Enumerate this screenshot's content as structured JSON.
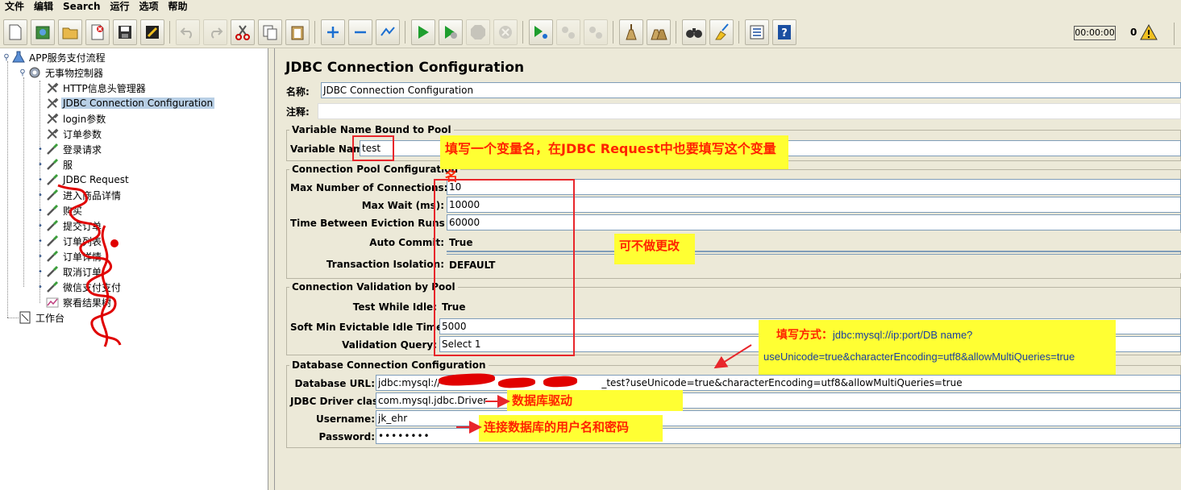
{
  "menu": [
    "文件",
    "编辑",
    "Search",
    "运行",
    "选项",
    "帮助"
  ],
  "toolbar": {
    "timer": "00:00:00",
    "error_count": "0"
  },
  "tree": {
    "root": "APP服务支付流程",
    "controller": "无事物控制器",
    "items": [
      "HTTP信息头管理器",
      "JDBC Connection Configuration",
      "login参数",
      "订单参数",
      "登录请求",
      "服",
      "JDBC Request",
      "进入商品详情",
      "购买",
      "提交订单",
      "订单列表",
      "订单详情",
      "取消订单",
      "微信支付支付",
      "察看结果树"
    ],
    "workbench": "工作台"
  },
  "main": {
    "title": "JDBC Connection Configuration",
    "name_label": "名称:",
    "name_value": "JDBC Connection Configuration",
    "comment_label": "注释:",
    "comment_value": "",
    "variable_group": {
      "legend": "Variable Name Bound to Pool",
      "variable_label": "Variable Name:",
      "variable_value": "test"
    },
    "pool_group": {
      "legend": "Connection Pool Configuration",
      "max_conn_label": "Max Number of Connections:",
      "max_conn_value": "10",
      "max_wait_label": "Max Wait (ms):",
      "max_wait_value": "10000",
      "eviction_label": "Time Between Eviction Runs (ms):",
      "eviction_value": "60000",
      "auto_commit_label": "Auto Commit:",
      "auto_commit_value": "True",
      "isolation_label": "Transaction Isolation:",
      "isolation_value": "DEFAULT"
    },
    "validation_group": {
      "legend": "Connection Validation by Pool",
      "test_idle_label": "Test While Idle:",
      "test_idle_value": "True",
      "soft_min_label": "Soft Min Evictable Idle Time(ms):",
      "soft_min_value": "5000",
      "query_label": "Validation Query:",
      "query_value": "Select 1"
    },
    "db_group": {
      "legend": "Database Connection Configuration",
      "url_label": "Database URL:",
      "url_prefix": "jdbc:mysql://",
      "url_suffix": "_test?useUnicode=true&characterEncoding=utf8&allowMultiQueries=true",
      "driver_label": "JDBC Driver class:",
      "driver_value": "com.mysql.jdbc.Driver",
      "username_label": "Username:",
      "username_value": "jk_ehr",
      "password_label": "Password:",
      "password_value": "••••••••"
    }
  },
  "annotations": {
    "variable_note": "填写一个变量名，在JDBC Request中也要填写这个变量名",
    "no_change_note": "可不做更改",
    "url_note_title": "填写方式：",
    "url_note_line1": "jdbc:mysql://ip:port/DB name?",
    "url_note_line2": "useUnicode=true&characterEncoding=utf8&allowMultiQueries=true",
    "driver_note": "数据库驱动",
    "credentials_note": "连接数据库的用户名和密码"
  },
  "colors": {
    "annotation_bg": "#ffff33",
    "annotation_text": "#ff2200",
    "annotation_red": "#e8262b",
    "selection": "#b8cfe5"
  }
}
